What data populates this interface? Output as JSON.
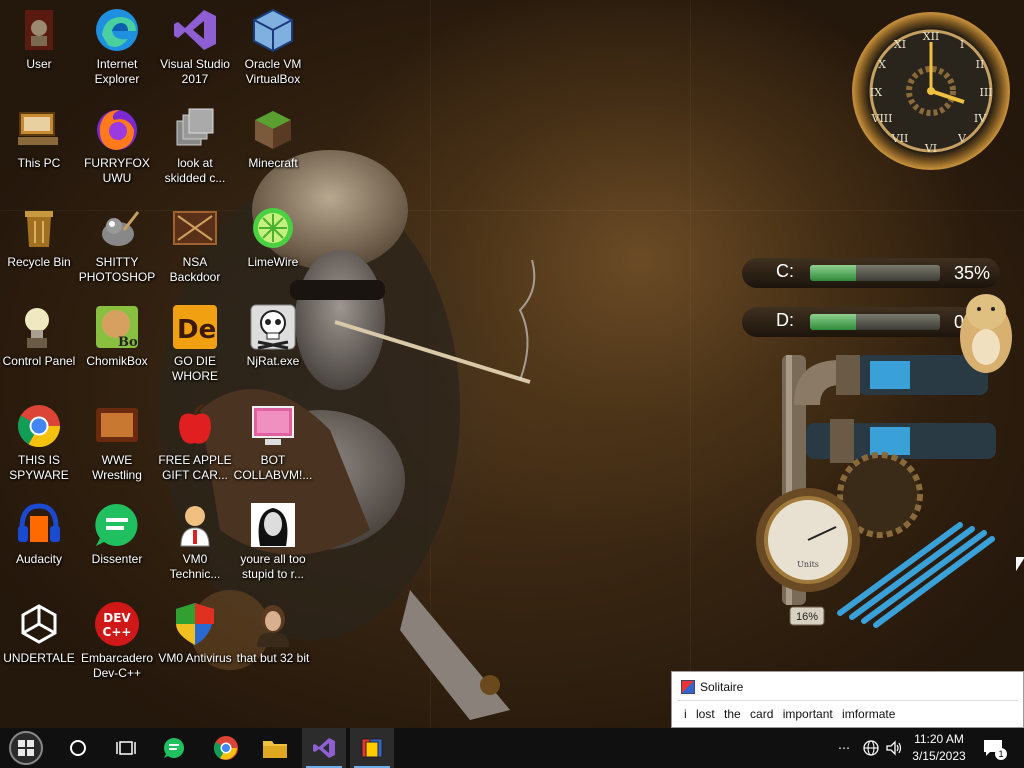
{
  "desktop_icons": [
    {
      "label": "User",
      "icon": "user-folder-icon"
    },
    {
      "label": "Internet\nExplorer",
      "icon": "edge-icon"
    },
    {
      "label": "Visual Studio\n2017",
      "icon": "visual-studio-icon"
    },
    {
      "label": "Oracle VM\nVirtualBox",
      "icon": "virtualbox-icon"
    },
    {
      "label": "This PC",
      "icon": "computer-icon"
    },
    {
      "label": "FURRYFOX\nUWU",
      "icon": "firefox-icon"
    },
    {
      "label": "look at\nskidded c...",
      "icon": "windows-copy-icon"
    },
    {
      "label": "Minecraft",
      "icon": "minecraft-icon"
    },
    {
      "label": "Recycle Bin",
      "icon": "recycle-bin-icon"
    },
    {
      "label": "SHITTY\nPHOTOSHOP",
      "icon": "gimp-icon"
    },
    {
      "label": "NSA\nBackdoor",
      "icon": "nsa-icon"
    },
    {
      "label": "LimeWire",
      "icon": "limewire-icon"
    },
    {
      "label": "Control Panel",
      "icon": "control-panel-icon"
    },
    {
      "label": "ChomikBox",
      "icon": "chomikbox-icon"
    },
    {
      "label": "GO DIE\nWHORE",
      "icon": "adobe-de-icon"
    },
    {
      "label": "NjRat.exe",
      "icon": "skull-icon"
    },
    {
      "label": "THIS IS\nSPYWARE",
      "icon": "chrome-icon"
    },
    {
      "label": "WWE\nWrestling",
      "icon": "tv-icon"
    },
    {
      "label": "FREE APPLE\nGIFT CAR...",
      "icon": "apple-icon"
    },
    {
      "label": "BOT\nCOLLABVM!...",
      "icon": "pink-monitor-icon"
    },
    {
      "label": "Audacity",
      "icon": "audacity-icon"
    },
    {
      "label": "Dissenter",
      "icon": "dissenter-icon"
    },
    {
      "label": "VM0\nTechnic...",
      "icon": "technician-icon"
    },
    {
      "label": "youre all too\nstupid to r...",
      "icon": "portrait-icon"
    },
    {
      "label": "UNDERTALE",
      "icon": "unity-icon"
    },
    {
      "label": "Embarcadero\nDev-C++",
      "icon": "devcpp-icon"
    },
    {
      "label": "VM0 Antivirus",
      "icon": "shield-icon"
    },
    {
      "label": "that but 32 bit",
      "icon": "portrait-lady-icon"
    }
  ],
  "gadgets": {
    "drives": [
      {
        "letter": "C:",
        "usage_percent": 35,
        "percent_label": "35%"
      },
      {
        "letter": "D:",
        "usage_percent": 35,
        "percent_label": "0"
      }
    ],
    "gauge_label": "16%",
    "gauge_text": "Units"
  },
  "notification": {
    "title": "Solitaire",
    "body": "i lost the card  important imformate"
  },
  "taskbar": {
    "time": "11:20 AM",
    "date": "3/15/2023",
    "notification_count": "1",
    "buttons": [
      "start-button",
      "cortana-button",
      "task-view-button",
      "dissenter-button",
      "chrome-button",
      "file-explorer-button",
      "visual-studio-button",
      "solitaire-button"
    ]
  }
}
